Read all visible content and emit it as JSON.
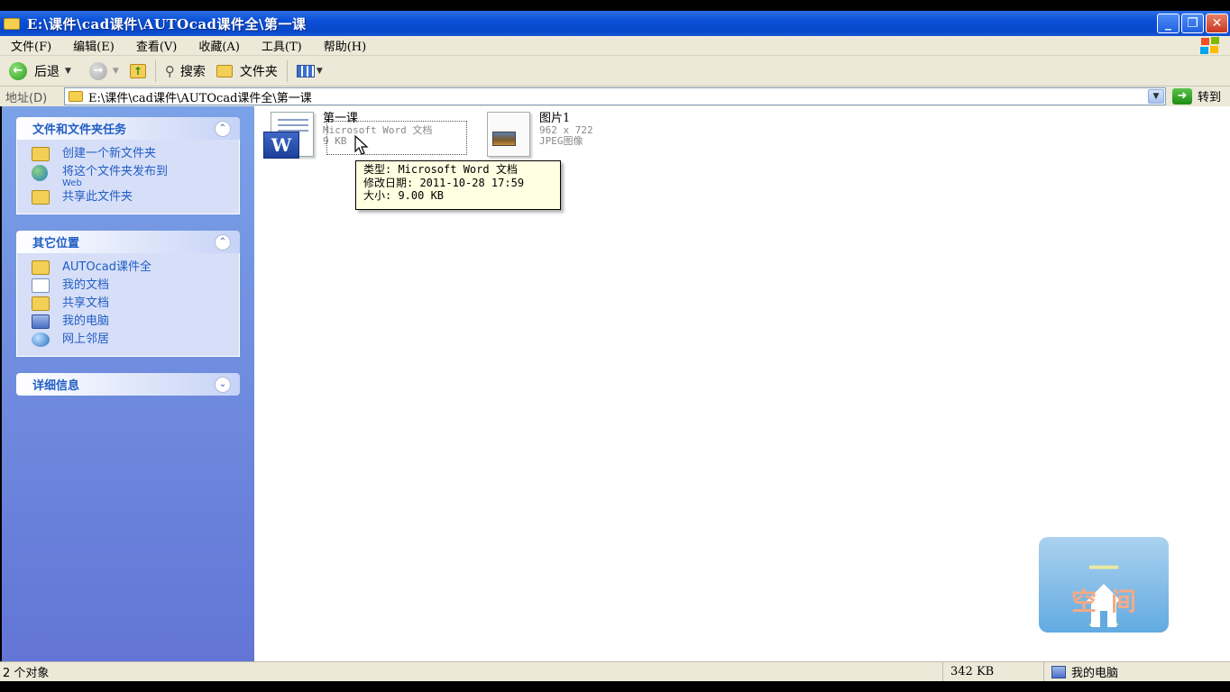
{
  "window": {
    "title": "E:\\课件\\cad课件\\AUTOcad课件全\\第一课",
    "minimize": "_",
    "maximize": "❐",
    "close": "✕"
  },
  "menu": [
    "文件(F)",
    "编辑(E)",
    "查看(V)",
    "收藏(A)",
    "工具(T)",
    "帮助(H)"
  ],
  "toolbar": {
    "back": "后退",
    "search": "搜索",
    "folders": "文件夹"
  },
  "address": {
    "label": "地址(D)",
    "value": "E:\\课件\\cad课件\\AUTOcad课件全\\第一课",
    "go": "转到"
  },
  "sidebar": {
    "tasks": {
      "title": "文件和文件夹任务",
      "items": [
        "创建一个新文件夹",
        "将这个文件夹发布到",
        "共享此文件夹"
      ],
      "web_sub": "Web"
    },
    "places": {
      "title": "其它位置",
      "items": [
        "AUTOcad课件全",
        "我的文档",
        "共享文档",
        "我的电脑",
        "网上邻居"
      ]
    },
    "details": {
      "title": "详细信息"
    }
  },
  "files": [
    {
      "name": "第一课",
      "type": "Microsoft Word 文档",
      "size": "9 KB",
      "icon": "word-document-icon"
    },
    {
      "name": "图片1",
      "type": "JPEG图像",
      "size": "962 x 722",
      "icon": "jpeg-image-icon"
    }
  ],
  "tooltip": {
    "line1": "类型: Microsoft Word 文档",
    "line2": "修改日期: 2011-10-28 17:59",
    "line3": "大小: 9.00 KB"
  },
  "watermark": {
    "top": "一点",
    "bottom": "空间"
  },
  "status": {
    "objects": "2 个对象",
    "size": "342 KB",
    "location": "我的电脑"
  }
}
